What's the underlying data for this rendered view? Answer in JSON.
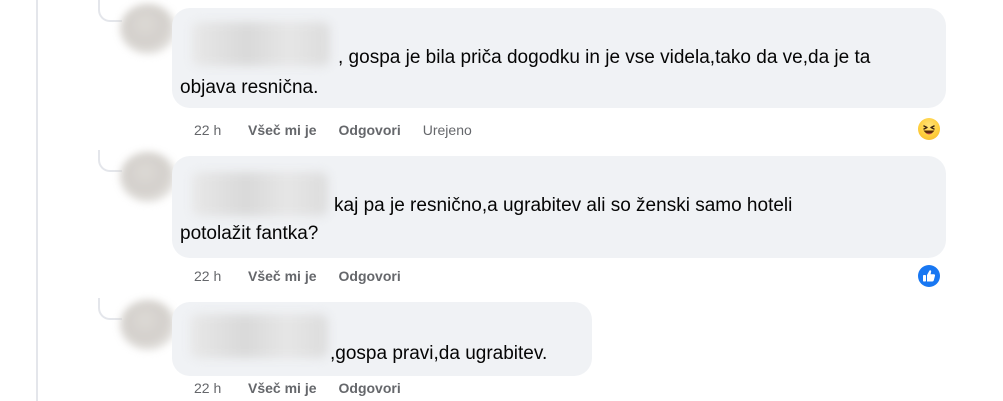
{
  "comments": [
    {
      "text_line1": ", gospa je bila priča dogodku in je vse videla,tako da ve,da je ta",
      "text_line2": "objava resnična.",
      "time": "22 h",
      "like_label": "Všeč mi je",
      "reply_label": "Odgovori",
      "edited_label": "Urejeno",
      "reaction_icon": "haha-emoji-icon"
    },
    {
      "text_line1": "kaj pa je resnično,a ugrabitev ali so ženski samo hoteli",
      "text_line2": "potolažit fantka?",
      "time": "22 h",
      "like_label": "Všeč mi je",
      "reply_label": "Odgovori",
      "reaction_icon": "like-thumb-icon"
    },
    {
      "text_line1": ",gospa pravi,da ugrabitev.",
      "time": "22 h",
      "like_label": "Všeč mi je",
      "reply_label": "Odgovori"
    }
  ],
  "colors": {
    "bubble": "#f0f2f5",
    "meta_text": "#65676b",
    "like_blue": "#1877f2",
    "haha_yellow": "#ffcf3d"
  }
}
